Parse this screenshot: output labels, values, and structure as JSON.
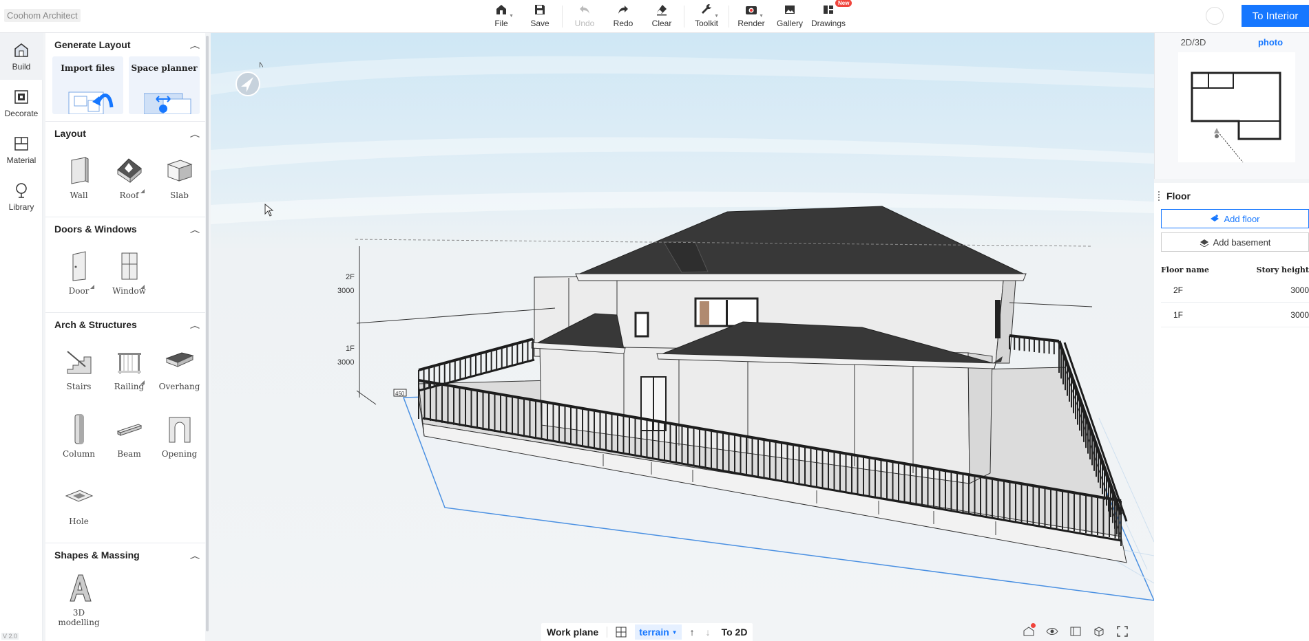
{
  "app": {
    "title": "Coohom Architect",
    "version": "V 2.0"
  },
  "toolbar": {
    "items": [
      {
        "label": "File",
        "icon": "home-icon"
      },
      {
        "label": "Save",
        "icon": "save-icon"
      },
      {
        "label": "Undo",
        "icon": "undo-icon"
      },
      {
        "label": "Redo",
        "icon": "redo-icon"
      },
      {
        "label": "Clear",
        "icon": "eraser-icon"
      },
      {
        "label": "Toolkit",
        "icon": "wrench-icon"
      },
      {
        "label": "Render",
        "icon": "camera-icon"
      },
      {
        "label": "Gallery",
        "icon": "gallery-icon"
      },
      {
        "label": "Drawings",
        "icon": "drawings-icon",
        "badge": "New"
      }
    ],
    "to_interior": "To Interior"
  },
  "leftnav": [
    {
      "label": "Build",
      "icon": "build-icon"
    },
    {
      "label": "Decorate",
      "icon": "decorate-icon"
    },
    {
      "label": "Material",
      "icon": "material-icon"
    },
    {
      "label": "Library",
      "icon": "library-icon"
    }
  ],
  "panel": {
    "generate_layout": {
      "title": "Generate Layout",
      "cards": [
        "Import files",
        "Space planner"
      ]
    },
    "layout": {
      "title": "Layout",
      "items": [
        "Wall",
        "Roof",
        "Slab"
      ]
    },
    "doors_windows": {
      "title": "Doors & Windows",
      "items": [
        "Door",
        "Window"
      ]
    },
    "arch": {
      "title": "Arch & Structures",
      "items": [
        "Stairs",
        "Railing",
        "Overhang",
        "Column",
        "Beam",
        "Opening",
        "Hole"
      ]
    },
    "shapes": {
      "title": "Shapes & Massing",
      "item_line1": "3D",
      "item_line2": "modelling"
    }
  },
  "viewport": {
    "compass_label": "N",
    "dims": {
      "f2": "2F",
      "f2_h": "3000",
      "f1": "1F",
      "f1_h": "3000",
      "base": "450"
    }
  },
  "bottombar": {
    "work_plane": "Work plane",
    "terrain": "terrain",
    "to2d": "To 2D"
  },
  "minimap": {
    "tabs": [
      "2D/3D",
      "photo"
    ]
  },
  "floor": {
    "title": "Floor",
    "add_floor": "Add floor",
    "add_basement": "Add basement",
    "col_name": "Floor name",
    "col_height": "Story height",
    "rows": [
      {
        "name": "2F",
        "height": "3000"
      },
      {
        "name": "1F",
        "height": "3000"
      }
    ]
  },
  "colors": {
    "accent": "#1677ff",
    "badge": "#f0443c",
    "roof": "#3a3a3a",
    "wall": "#eeeeee"
  }
}
